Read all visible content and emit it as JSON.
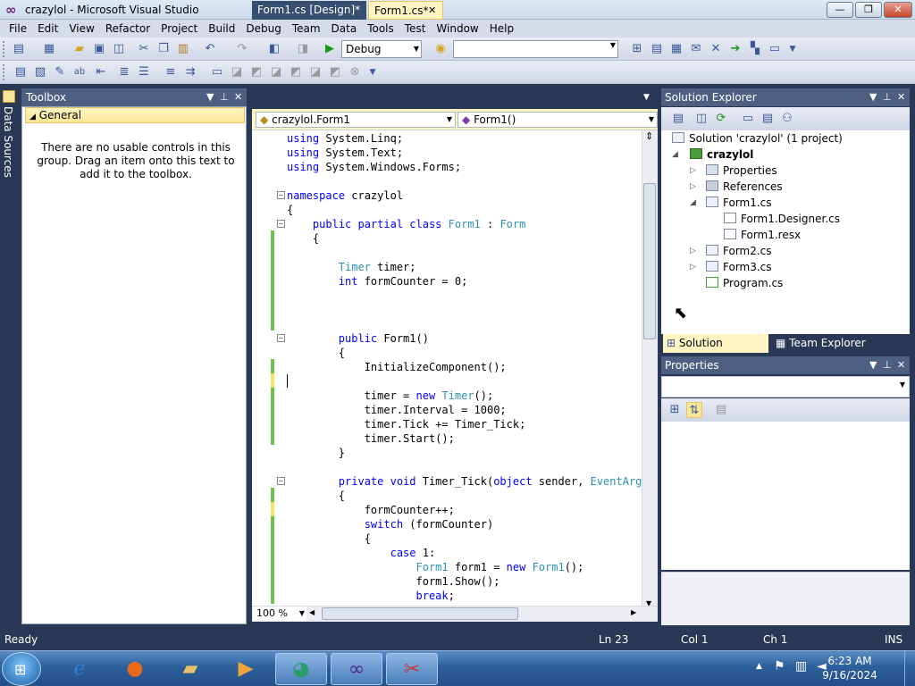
{
  "window": {
    "title": "crazylol - Microsoft Visual Studio",
    "icon": "visual-studio-icon"
  },
  "menu": [
    "File",
    "Edit",
    "View",
    "Refactor",
    "Project",
    "Build",
    "Debug",
    "Team",
    "Data",
    "Tools",
    "Test",
    "Window",
    "Help"
  ],
  "toolbar": {
    "configuration": "Debug",
    "platform": ""
  },
  "side_strip": {
    "label": "Data Sources"
  },
  "toolbox": {
    "title": "Toolbox",
    "group": "General",
    "message": "There are no usable controls in this group. Drag an item onto this text to add it to the toolbox."
  },
  "editor": {
    "tabs": [
      {
        "label": "Form1.cs [Design]*"
      },
      {
        "label": "Form1.cs*",
        "close": "✕"
      }
    ],
    "type_dropdown": "crazylol.Form1",
    "member_dropdown": "Form1()",
    "zoom": "100 %",
    "lines": [
      "using System.Linq;",
      "using System.Text;",
      "using System.Windows.Forms;",
      "",
      "namespace crazylol",
      "{",
      "    public partial class Form1 : Form",
      "    {",
      "",
      "        Timer timer;",
      "        int formCounter = 0;",
      "",
      "",
      "",
      "        public Form1()",
      "        {",
      "            InitializeComponent();",
      "",
      "            timer = new Timer();",
      "            timer.Interval = 1000;",
      "            timer.Tick += Timer_Tick;",
      "            timer.Start();",
      "        }",
      "",
      "        private void Timer_Tick(object sender, EventArgs",
      "        {",
      "            formCounter++;",
      "            switch (formCounter)",
      "            {",
      "                case 1:",
      "                    Form1 form1 = new Form1();",
      "                    form1.Show();",
      "                    break;"
    ]
  },
  "solution_explorer": {
    "title": "Solution Explorer",
    "solution": "Solution 'crazylol' (1 project)",
    "project": "crazylol",
    "items": [
      "Properties",
      "References",
      "Form1.cs",
      "Form1.Designer.cs",
      "Form1.resx",
      "Form2.cs",
      "Form3.cs",
      "Program.cs"
    ],
    "tabs": [
      "Solution Explorer",
      "Team Explorer"
    ]
  },
  "properties": {
    "title": "Properties"
  },
  "status": {
    "ready": "Ready",
    "ln": "Ln 23",
    "col": "Col 1",
    "ch": "Ch 1",
    "mode": "INS"
  },
  "taskbar": {
    "time": "6:23 AM",
    "date": "9/16/2024"
  },
  "colors": {
    "keyword": "#0000ff",
    "type": "#2b91af",
    "panel_header": "#4d6082",
    "ide_background": "#293955"
  }
}
